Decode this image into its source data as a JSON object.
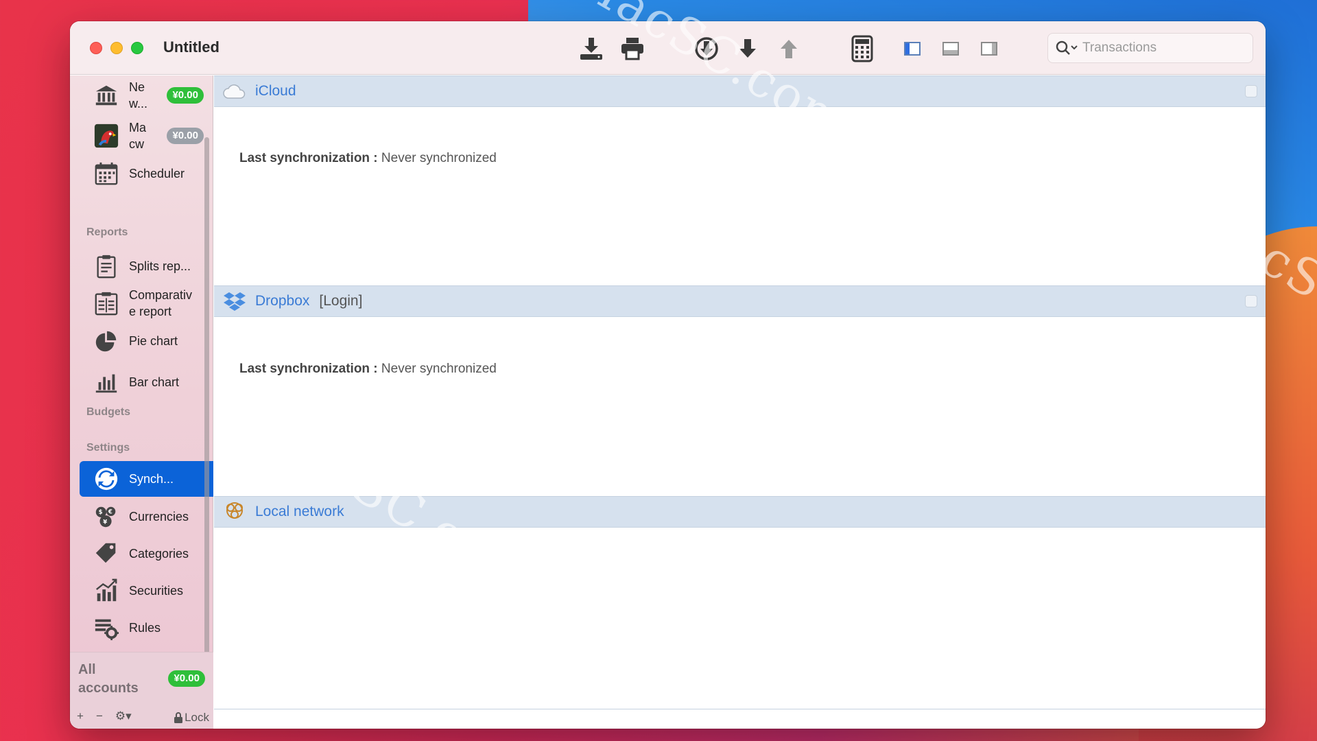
{
  "window": {
    "title": "Untitled"
  },
  "toolbar": {
    "buttons": [
      {
        "name": "download-icon"
      },
      {
        "name": "print-icon"
      },
      {
        "name": "sync-download-icon"
      },
      {
        "name": "arrow-down-icon"
      },
      {
        "name": "arrow-up-icon"
      },
      {
        "name": "calculator-icon"
      },
      {
        "name": "sidebar-left-icon"
      },
      {
        "name": "panel-bottom-icon"
      },
      {
        "name": "sidebar-right-icon"
      }
    ]
  },
  "search": {
    "placeholder": "Transactions"
  },
  "sidebar": {
    "items": [
      {
        "label": "Ne w...",
        "badge": "¥0.00",
        "badge_color": "green"
      },
      {
        "label": "Ma cw",
        "badge": "¥0.00",
        "badge_color": "grey"
      },
      {
        "label": "Scheduler"
      }
    ],
    "sections": {
      "reports": "Reports",
      "budgets": "Budgets",
      "settings": "Settings"
    },
    "reports": [
      {
        "label": "Splits rep..."
      },
      {
        "label": "Comparativ e report"
      },
      {
        "label": "Pie chart"
      },
      {
        "label": "Bar chart"
      }
    ],
    "settings": [
      {
        "label": "Synch...",
        "active": true
      },
      {
        "label": "Currencies"
      },
      {
        "label": "Categories"
      },
      {
        "label": "Securities"
      },
      {
        "label": "Rules"
      }
    ],
    "footer": {
      "all_accounts": "All accounts",
      "all_badge": "¥0.00",
      "add": "+",
      "remove": "−",
      "gear": "⚙▾",
      "lock": "Lock"
    }
  },
  "sync": {
    "icloud": {
      "name": "iCloud",
      "last_sync_label": "Last synchronization :",
      "last_sync_value": "Never synchronized"
    },
    "dropbox": {
      "name": "Dropbox",
      "login": "[Login]",
      "last_sync_label": "Last synchronization :",
      "last_sync_value": "Never synchronized"
    },
    "local": {
      "name": "Local network"
    }
  },
  "watermarks": [
    "MacSC.com",
    "MacSC.com",
    "MacSC.com"
  ],
  "colors": {
    "accent": "#0b63d8",
    "badge_green": "#2fbf3a",
    "link_blue": "#3a7bd5",
    "header_bg": "#d6e1ee"
  }
}
